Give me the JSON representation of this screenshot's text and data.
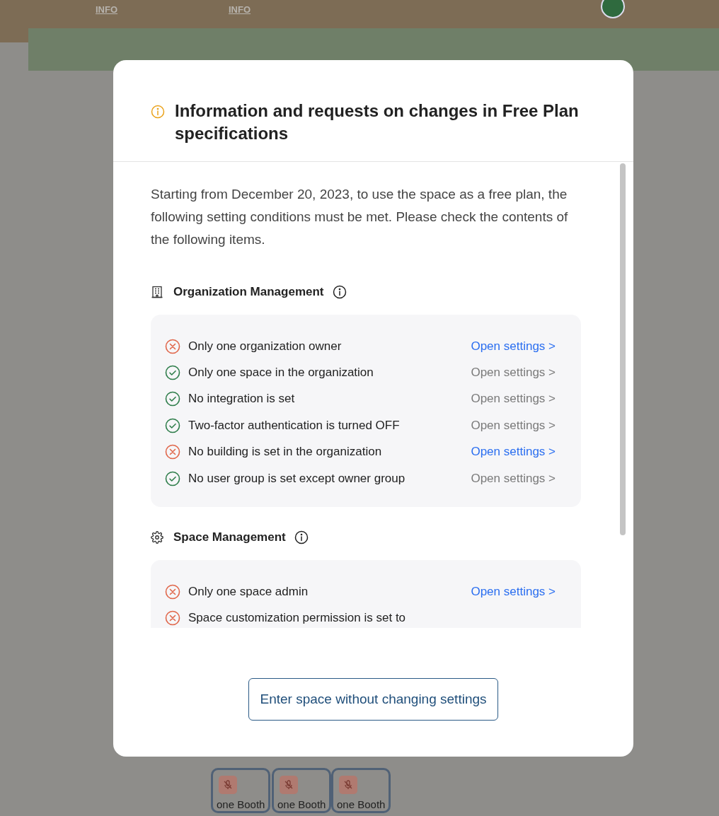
{
  "scene": {
    "labels": [
      "INFO",
      "INFO"
    ],
    "booths": [
      {
        "name": "one Booth",
        "muted": true
      },
      {
        "name": "one Booth",
        "muted": true
      },
      {
        "name": "one Booth",
        "muted": true
      }
    ]
  },
  "dialog": {
    "title": "Information and requests on changes in Free Plan specifications",
    "intro": "Starting from December 20, 2023, to use the space as a free plan, the following setting conditions must be met. Please check the contents of the following items.",
    "sections": [
      {
        "kind": "organization",
        "heading": "Organization Management",
        "items": [
          {
            "text": "Only one organization owner",
            "passed": false,
            "action": {
              "label": "Open settings >",
              "disabled": false
            }
          },
          {
            "text": "Only one space in the organization",
            "passed": true,
            "action": {
              "label": "Open settings >",
              "disabled": true
            }
          },
          {
            "text": "No integration is set",
            "passed": true,
            "action": {
              "label": "Open settings >",
              "disabled": true
            }
          },
          {
            "text": "Two-factor authentication is turned OFF",
            "passed": true,
            "action": {
              "label": "Open settings >",
              "disabled": true
            }
          },
          {
            "text": "No building is set in the organization",
            "passed": false,
            "action": {
              "label": "Open settings >",
              "disabled": false
            }
          },
          {
            "text": "No user group is set except owner group",
            "passed": true,
            "action": {
              "label": "Open settings >",
              "disabled": true
            }
          }
        ]
      },
      {
        "kind": "space",
        "heading": "Space Management",
        "items": [
          {
            "text": "Only one space admin",
            "passed": false,
            "action": {
              "label": "Open settings >",
              "disabled": false
            }
          },
          {
            "text": "Space customization permission is set to",
            "passed": false
          }
        ]
      }
    ],
    "button": "Enter space without changing settings"
  }
}
